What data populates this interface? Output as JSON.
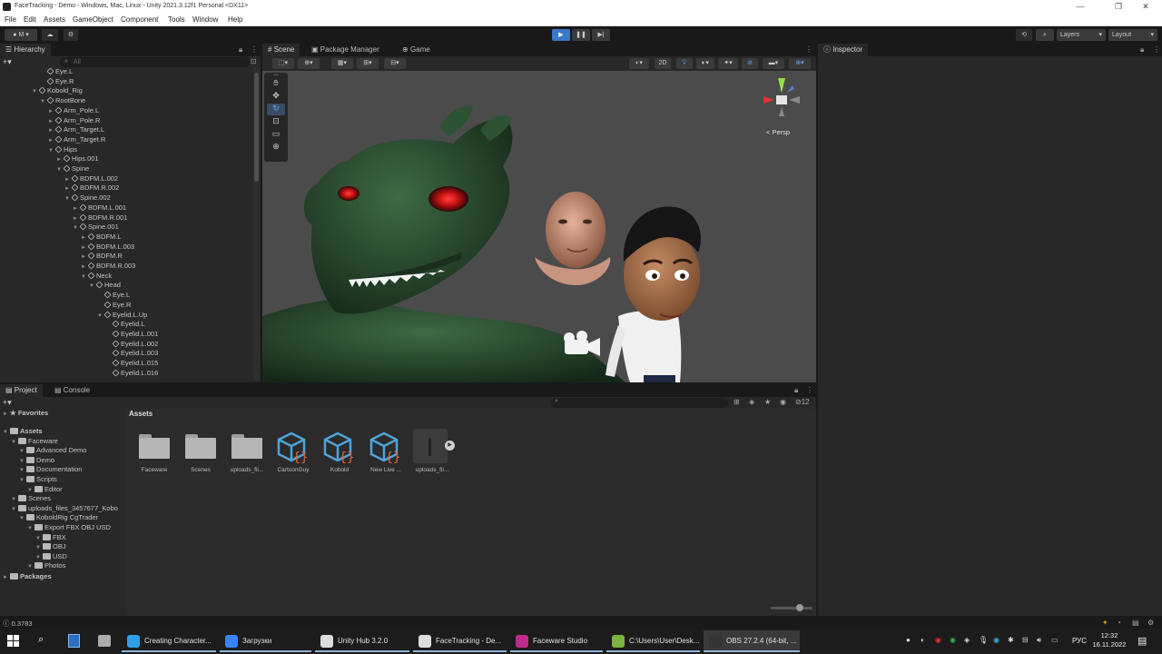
{
  "window": {
    "title": "FaceTracking - Demo - Windows, Mac, Linux - Unity 2021.3.12f1 Personal <DX11>",
    "controls": {
      "minimize": "—",
      "maximize": "❐",
      "close": "✕"
    }
  },
  "menu": [
    "File",
    "Edit",
    "Assets",
    "GameObject",
    "Component",
    "Tools",
    "Window",
    "Help"
  ],
  "toolbar": {
    "account": "M",
    "layers": "Layers",
    "layout": "Layout"
  },
  "hierarchy": {
    "tab": "Hierarchy",
    "search_placeholder": "All",
    "rows": [
      {
        "label": "Eye.L",
        "depth": 1,
        "arrow": ""
      },
      {
        "label": "Eye.R",
        "depth": 1,
        "arrow": ""
      },
      {
        "label": "Kobold_Rig",
        "depth": 0,
        "arrow": "▼"
      },
      {
        "label": "RootBone",
        "depth": 1,
        "arrow": "▼"
      },
      {
        "label": "Arm_Pole.L",
        "depth": 2,
        "arrow": "►"
      },
      {
        "label": "Arm_Pole.R",
        "depth": 2,
        "arrow": "►"
      },
      {
        "label": "Arm_Target.L",
        "depth": 2,
        "arrow": "►"
      },
      {
        "label": "Arm_Target.R",
        "depth": 2,
        "arrow": "►"
      },
      {
        "label": "Hips",
        "depth": 2,
        "arrow": "▼"
      },
      {
        "label": "Hips.001",
        "depth": 3,
        "arrow": "►"
      },
      {
        "label": "Spine",
        "depth": 3,
        "arrow": "▼"
      },
      {
        "label": "BDFM.L.002",
        "depth": 4,
        "arrow": "►"
      },
      {
        "label": "BDFM.R.002",
        "depth": 4,
        "arrow": "►"
      },
      {
        "label": "Spine.002",
        "depth": 4,
        "arrow": "▼"
      },
      {
        "label": "BDFM.L.001",
        "depth": 5,
        "arrow": "►"
      },
      {
        "label": "BDFM.R.001",
        "depth": 5,
        "arrow": "►"
      },
      {
        "label": "Spine.001",
        "depth": 5,
        "arrow": "▼"
      },
      {
        "label": "BDFM.L",
        "depth": 6,
        "arrow": "►"
      },
      {
        "label": "BDFM.L.003",
        "depth": 6,
        "arrow": "►"
      },
      {
        "label": "BDFM.R",
        "depth": 6,
        "arrow": "►"
      },
      {
        "label": "BDFM.R.003",
        "depth": 6,
        "arrow": "►"
      },
      {
        "label": "Neck",
        "depth": 6,
        "arrow": "▼"
      },
      {
        "label": "Head",
        "depth": 7,
        "arrow": "▼"
      },
      {
        "label": "Eye.L",
        "depth": 8,
        "arrow": ""
      },
      {
        "label": "Eye.R",
        "depth": 8,
        "arrow": ""
      },
      {
        "label": "Eyelid.L.Up",
        "depth": 8,
        "arrow": "▼"
      },
      {
        "label": "Eyelid.L",
        "depth": 9,
        "arrow": ""
      },
      {
        "label": "Eyelid.L.001",
        "depth": 9,
        "arrow": ""
      },
      {
        "label": "Eyelid.L.002",
        "depth": 9,
        "arrow": ""
      },
      {
        "label": "Eyelid.L.003",
        "depth": 9,
        "arrow": ""
      },
      {
        "label": "Eyelid.L.015",
        "depth": 9,
        "arrow": ""
      },
      {
        "label": "Eyelid.L.016",
        "depth": 9,
        "arrow": ""
      }
    ]
  },
  "scene": {
    "tabs": [
      "Scene",
      "Package Manager",
      "Game"
    ],
    "mode_2d": "2D",
    "persp_label": "< Persp"
  },
  "inspector": {
    "tab": "Inspector"
  },
  "project": {
    "tabs": [
      "Project",
      "Console"
    ],
    "favorites": "Favorites",
    "assets_header": "Assets",
    "badge_count": "12",
    "tree": [
      {
        "label": "Assets",
        "depth": 0
      },
      {
        "label": "Faceware",
        "depth": 1
      },
      {
        "label": "Advanced Demo",
        "depth": 2
      },
      {
        "label": "Demo",
        "depth": 2
      },
      {
        "label": "Documentation",
        "depth": 2
      },
      {
        "label": "Scripts",
        "depth": 2
      },
      {
        "label": "Editor",
        "depth": 3
      },
      {
        "label": "Scenes",
        "depth": 1
      },
      {
        "label": "uploads_files_3457677_Kobo",
        "depth": 1
      },
      {
        "label": "KoboldRig CgTrader",
        "depth": 2
      },
      {
        "label": "Export FBX OBJ USD",
        "depth": 3
      },
      {
        "label": "FBX",
        "depth": 4
      },
      {
        "label": "OBJ",
        "depth": 4
      },
      {
        "label": "USD",
        "depth": 4
      },
      {
        "label": "Photos",
        "depth": 3
      }
    ],
    "packages": "Packages",
    "assets": [
      {
        "label": "Faceware",
        "kind": "folder"
      },
      {
        "label": "Scenes",
        "kind": "folder"
      },
      {
        "label": "uploads_fil...",
        "kind": "folder"
      },
      {
        "label": "CartoonGuy",
        "kind": "prefab"
      },
      {
        "label": "Kobold",
        "kind": "prefab"
      },
      {
        "label": "New Live ...",
        "kind": "prefab"
      },
      {
        "label": "uploads_fil...",
        "kind": "model"
      }
    ]
  },
  "status": {
    "value": "0.3783"
  },
  "taskbar": {
    "items": [
      {
        "label": "Creating Character...",
        "color": "#2fa0e8"
      },
      {
        "label": "Загрузки",
        "color": "#3b82f6"
      },
      {
        "label": "Unity Hub 3.2.0",
        "color": "#dddddd"
      },
      {
        "label": "FaceTracking - De...",
        "color": "#dddddd"
      },
      {
        "label": "Faceware Studio",
        "color": "#c02a8a"
      },
      {
        "label": "C:\\Users\\User\\Desk...",
        "color": "#7cb342"
      },
      {
        "label": "OBS 27.2.4 (64-bit, ...",
        "color": "#333333"
      }
    ],
    "lang": "РУС",
    "time": "12:32",
    "date": "16.11.2022"
  },
  "colors": {
    "accent_play": "#3a79c8",
    "kobold_green": "#2b4a2e",
    "kobold_eye": "#d11a1a"
  }
}
